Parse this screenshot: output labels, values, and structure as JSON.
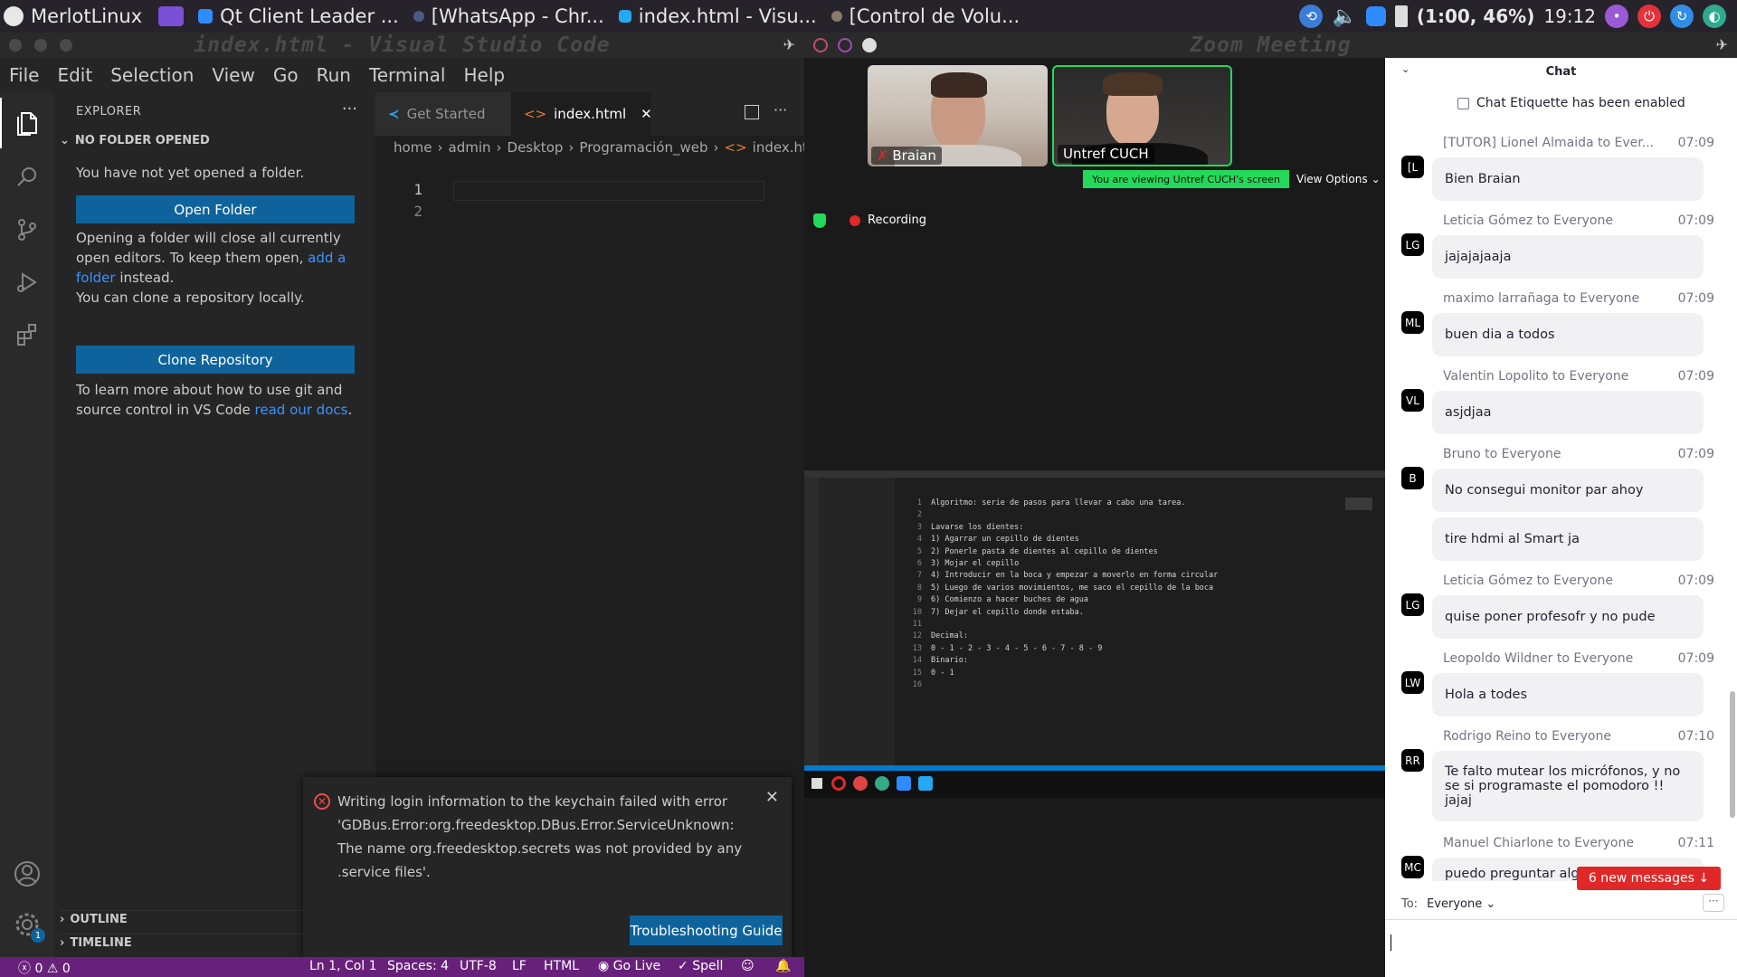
{
  "taskbar": {
    "apps": [
      {
        "label": "MerlotLinux",
        "color": "#e8e8e8"
      },
      {
        "label": "",
        "color": "#7b4fd6"
      },
      {
        "label": "Qt Client Leader ...",
        "color": "#2d8cff"
      },
      {
        "label": "[WhatsApp - Chr...",
        "color": "#4a5a8a"
      },
      {
        "label": "index.html - Visu...",
        "color": "#23a9f2"
      },
      {
        "label": "[Control de Volu...",
        "color": "#8a7a6a"
      }
    ],
    "battery": "(1:00, 46%)",
    "clock": "19:12"
  },
  "vscode": {
    "window_title": "index.html - Visual Studio Code",
    "menu": [
      "File",
      "Edit",
      "Selection",
      "View",
      "Go",
      "Run",
      "Terminal",
      "Help"
    ],
    "explorer": {
      "header": "EXPLORER",
      "section": "NO FOLDER OPENED",
      "no_folder_text": "You have not yet opened a folder.",
      "open_folder_button": "Open Folder",
      "warning_prefix": "Opening a folder will close all currently open editors. To keep them open, ",
      "warning_link": "add a folder",
      "warning_suffix": " instead.",
      "clone_text": "You can clone a repository locally.",
      "clone_button": "Clone Repository",
      "git_prefix": "To learn more about how to use git and source control in VS Code ",
      "git_link": "read our docs",
      "git_suffix": ".",
      "outline": "OUTLINE",
      "timeline": "TIMELINE"
    },
    "tabs": [
      {
        "label": "Get Started",
        "active": false
      },
      {
        "label": "index.html",
        "active": true
      }
    ],
    "breadcrumb": [
      "home",
      "admin",
      "Desktop",
      "Programación_web",
      "index.html"
    ],
    "line_numbers": [
      "1",
      "2"
    ],
    "notification": {
      "message": "Writing login information to the keychain failed with error 'GDBus.Error:org.freedesktop.DBus.Error.ServiceUnknown: The name org.freedesktop.secrets was not provided by any .service files'.",
      "button": "Troubleshooting Guide"
    },
    "status": {
      "errors": "0",
      "warnings": "0",
      "position": "Ln 1, Col 1",
      "spaces": "Spaces: 4",
      "encoding": "UTF-8",
      "eol": "LF",
      "language": "HTML",
      "golive": "Go Live",
      "spell": "Spell",
      "accounts_badge": "1"
    }
  },
  "zoom": {
    "window_title": "Zoom Meeting",
    "participants": [
      {
        "name": "Braian",
        "muted": true
      },
      {
        "name": "Untref CUCH",
        "muted": false
      }
    ],
    "viewing_banner": "You are viewing Untref CUCH's screen",
    "view_options": "View Options",
    "recording": "Recording",
    "shared_code": [
      "Algoritmo: serie de pasos para llevar a cabo una tarea.",
      "",
      "Lavarse los dientes:",
      "1) Agarrar un cepillo de dientes",
      "2) Ponerle pasta de dientes al cepillo de dientes",
      "3) Mojar el cepillo",
      "4) Introducir en la boca y empezar a moverlo en forma circular",
      "5) Luego de varios movimientos, me saco el cepillo de la boca",
      "6) Comienzo a hacer buches de agua",
      "7) Dejar el cepillo donde estaba.",
      "",
      "Decimal:",
      "0 - 1 - 2 - 3 - 4 - 5 - 6 - 7 - 8 - 9",
      "Binario:",
      "0 - 1",
      ""
    ],
    "chat": {
      "title": "Chat",
      "etiquette": "Chat Etiquette has been enabled",
      "messages": [
        {
          "from": "[TUTOR] Lionel Almaida to Ever...",
          "time": "07:09",
          "avatar": "[L",
          "text": "Bien Braian"
        },
        {
          "from": "Leticia Gómez to Everyone",
          "time": "07:09",
          "avatar": "LG",
          "text": "jajajajaaja"
        },
        {
          "from": "maximo larrañaga to Everyone",
          "time": "07:09",
          "avatar": "ML",
          "text": "buen dia a todos"
        },
        {
          "from": "Valentin Lopolito to Everyone",
          "time": "07:09",
          "avatar": "VL",
          "text": "asjdjaa"
        },
        {
          "from": "Bruno to Everyone",
          "time": "07:09",
          "avatar": "B",
          "text": "No consegui monitor par ahoy",
          "extra": "tire hdmi al Smart ja"
        },
        {
          "from": "Leticia Gómez to Everyone",
          "time": "07:09",
          "avatar": "LG",
          "text": "quise poner profesofr y no pude"
        },
        {
          "from": "Leopoldo Wildner to Everyone",
          "time": "07:09",
          "avatar": "LW",
          "text": "Hola a todes"
        },
        {
          "from": "Rodrigo Reino to Everyone",
          "time": "07:10",
          "avatar": "RR",
          "text": "Te falto mutear los micrófonos, y no se si programaste el pomodoro !! jajaj"
        },
        {
          "from": "Manuel Chiarlone to Everyone",
          "time": "07:11",
          "avatar": "MC",
          "text": "puedo preguntar algo? o espero a que lo expliques vimos? o espero a que lo expliques"
        }
      ],
      "new_messages": "6 new messages ↓",
      "to_label": "To:",
      "to_value": "Everyone"
    }
  }
}
